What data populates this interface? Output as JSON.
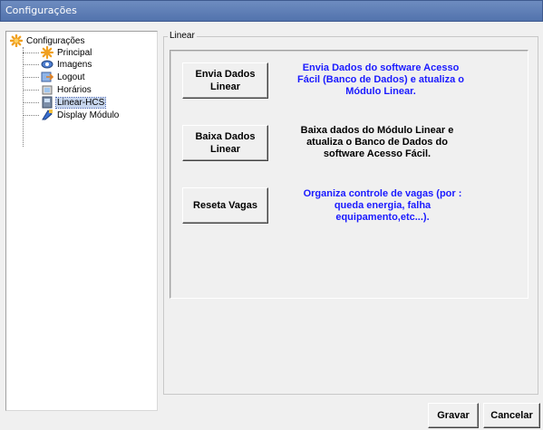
{
  "window": {
    "title": "Configurações"
  },
  "tree": {
    "root": "Configurações",
    "items": [
      {
        "label": "Principal",
        "icon": "star-icon",
        "selected": false
      },
      {
        "label": "Imagens",
        "icon": "image-icon",
        "selected": false
      },
      {
        "label": "Logout",
        "icon": "logout-icon",
        "selected": false
      },
      {
        "label": "Horários",
        "icon": "clock-icon",
        "selected": false
      },
      {
        "label": "Linear-HCS",
        "icon": "device-icon",
        "selected": true
      },
      {
        "label": "Display Módulo",
        "icon": "display-icon",
        "selected": false
      }
    ]
  },
  "group": {
    "label": "Linear"
  },
  "actions": [
    {
      "button": "Envia Dados\nLinear",
      "description": "Envia Dados do software Acesso\nFácil (Banco de Dados) e atualiza o\nMódulo Linear.",
      "color": "#1a1aff"
    },
    {
      "button": "Baixa Dados\nLinear",
      "description": "Baixa dados do Módulo Linear e\natualiza o Banco de Dados do\nsoftware Acesso Fácil.",
      "color": "#000000"
    },
    {
      "button": "Reseta Vagas",
      "description": "Organiza controle de vagas (por :\nqueda energia, falha\nequipamento,etc...).",
      "color": "#1a1aff"
    }
  ],
  "footer": {
    "save": "Gravar",
    "cancel": "Cancelar"
  }
}
